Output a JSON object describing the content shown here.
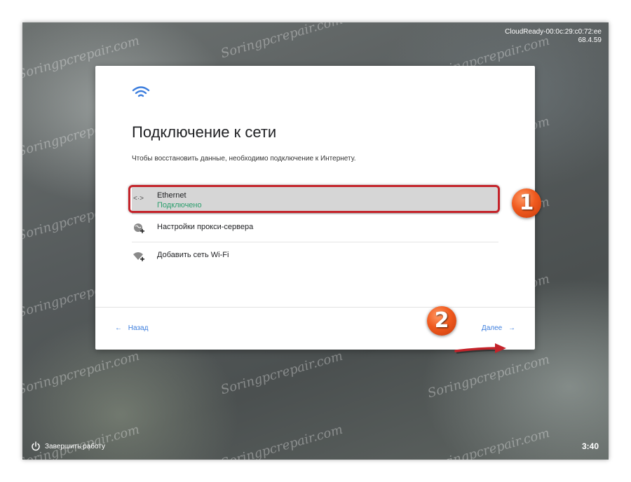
{
  "device": {
    "hostname": "CloudReady-00:0c:29:c0:72:ee",
    "version": "68.4.59"
  },
  "dialog": {
    "title": "Подключение к сети",
    "subtitle": "Чтобы восстановить данные, необходимо подключение к Интернету.",
    "networks": [
      {
        "label": "Ethernet",
        "status": "Подключено",
        "icon": "ethernet-icon"
      },
      {
        "label": "Настройки прокси-сервера",
        "icon": "globe-plus-icon"
      },
      {
        "label": "Добавить сеть Wi-Fi",
        "icon": "wifi-plus-icon"
      }
    ],
    "back_label": "Назад",
    "next_label": "Далее"
  },
  "annotations": {
    "badge1": "1",
    "badge2": "2"
  },
  "taskbar": {
    "shutdown_label": "Завершить работу",
    "clock": "3:40"
  },
  "watermark": "Soringpcrepair.com",
  "colors": {
    "accent": "#3b7ddd",
    "connected": "#2b9e6d",
    "annotation": "#c4232a",
    "badge": "#f05a1e"
  }
}
